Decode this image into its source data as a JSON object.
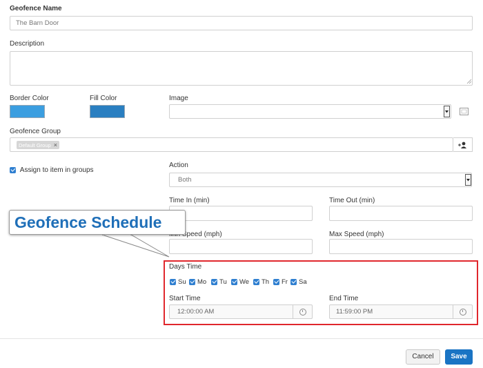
{
  "form": {
    "name_label": "Geofence Name",
    "name_value": "The Barn Door",
    "description_label": "Description",
    "description_value": "",
    "border_color_label": "Border Color",
    "border_color": "#3b9ee0",
    "fill_color_label": "Fill Color",
    "fill_color": "#2a7fc1",
    "image_label": "Image",
    "image_value": "",
    "group_label": "Geofence Group",
    "group_tag": "Default Group",
    "group_tag_remove": "×",
    "assign_label": "Assign to item in groups",
    "assign_checked": true,
    "action_label": "Action",
    "action_value": "Both",
    "time_in_label": "Time In (min)",
    "time_out_label": "Time Out (min)",
    "min_speed_label": "Min Speed (mph)",
    "max_speed_label": "Max Speed (mph)"
  },
  "schedule": {
    "callout_text": "Geofence Schedule",
    "days_time_label": "Days Time",
    "days": [
      "Su",
      "Mo",
      "Tu",
      "We",
      "Th",
      "Fr",
      "Sa"
    ],
    "start_time_label": "Start Time",
    "start_time_value": "12:00:00 AM",
    "end_time_label": "End Time",
    "end_time_value": "11:59:00 PM"
  },
  "footer": {
    "cancel_label": "Cancel",
    "save_label": "Save"
  },
  "colors": {
    "accent": "#1a74c4",
    "checkbox": "#2f7fd0",
    "highlight_border": "#e0262c",
    "callout_text": "#1f6fb8"
  },
  "icons": {
    "image_dropdown": "chevron-down-icon",
    "image_picker": "image-icon",
    "group_add": "add-user-icon",
    "time_picker": "clock-icon"
  }
}
